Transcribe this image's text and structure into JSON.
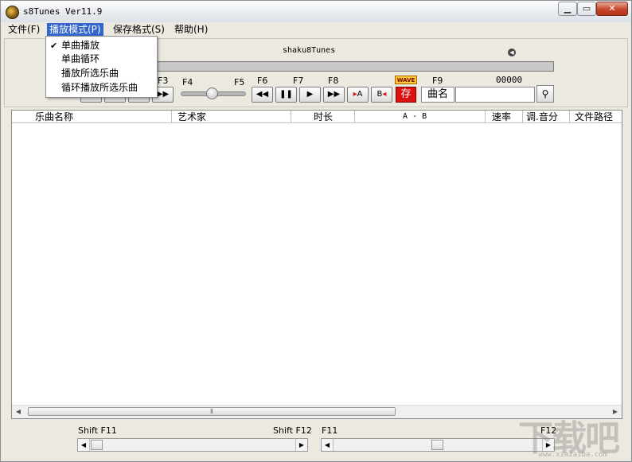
{
  "window": {
    "title": "s8Tunes Ver11.9"
  },
  "menubar": {
    "items": [
      "文件(F)",
      "播放模式(P)",
      "保存格式(S)",
      "帮助(H)"
    ]
  },
  "dropdown": {
    "checked_index": 0,
    "check_glyph": "✔",
    "items": [
      "单曲播放",
      "单曲循环",
      "播放所选乐曲",
      "循环播放所选乐曲"
    ]
  },
  "player": {
    "song_title": "shaku8Tunes",
    "counter": "00000",
    "wave_label": "WAVE",
    "save_label": "存",
    "search_label": "曲名",
    "search_value": "",
    "fkeys": {
      "f3": "F3",
      "f4": "F4",
      "f5": "F5",
      "f6": "F6",
      "f7": "F7",
      "f8": "F8",
      "f9": "F9"
    },
    "ab": {
      "a": "A",
      "b": "B"
    }
  },
  "table": {
    "columns": [
      "乐曲名称",
      "艺术家",
      "时长",
      "A - B",
      "速率",
      "调.音分",
      "文件路径"
    ]
  },
  "bottom": {
    "left_start": "Shift F11",
    "left_end": "Shift F12",
    "right_start": "F11",
    "right_end": "F12"
  },
  "watermark": {
    "text": "下载吧",
    "url": "www.xiazaiba.com"
  },
  "colors": {
    "menu_active": "#3366cc",
    "save_button": "#dd1111",
    "wave_badge": "#ffcc33"
  }
}
